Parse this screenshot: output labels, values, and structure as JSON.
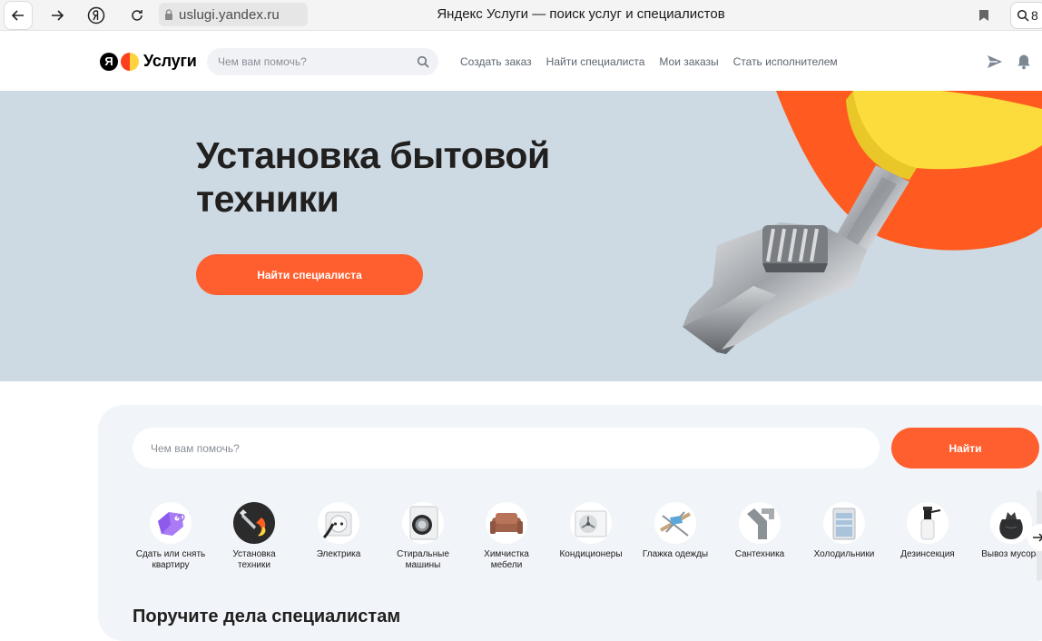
{
  "browser": {
    "url": "uslugi.yandex.ru",
    "tab_title": "Яндекс Услуги — поиск услуг и специалистов",
    "zoom_label": "8"
  },
  "header": {
    "logo_ya": "Я",
    "logo_text": "Услуги",
    "search_placeholder": "Чем вам помочь?",
    "nav": [
      "Создать заказ",
      "Найти специалиста",
      "Мои заказы",
      "Стать исполнителем"
    ]
  },
  "hero": {
    "title": "Установка бытовой техники",
    "button_label": "Найти специалиста"
  },
  "main": {
    "search_placeholder": "Чем вам помочь?",
    "find_label": "Найти",
    "categories": [
      {
        "label": "Сдать или снять\nквартиру",
        "icon": "tag-icon"
      },
      {
        "label": "Установка\nтехники",
        "icon": "wrench-icon"
      },
      {
        "label": "Электрика",
        "icon": "socket-icon"
      },
      {
        "label": "Стиральные\nмашины",
        "icon": "washing-machine-icon"
      },
      {
        "label": "Химчистка\nмебели",
        "icon": "sofa-icon"
      },
      {
        "label": "Кондиционеры",
        "icon": "air-conditioner-icon"
      },
      {
        "label": "Глажка одежды",
        "icon": "iron-icon"
      },
      {
        "label": "Сантехника",
        "icon": "pipe-icon"
      },
      {
        "label": "Холодильники",
        "icon": "fridge-icon"
      },
      {
        "label": "Дезинсекция",
        "icon": "sprayer-icon"
      },
      {
        "label": "Вывоз мусора",
        "icon": "trash-bag-icon"
      }
    ],
    "section_title": "Поручите дела специалистам"
  },
  "colors": {
    "accent": "#ff5f2e",
    "hero_bg": "#cdd9e3",
    "card_bg": "#f1f4f8"
  }
}
